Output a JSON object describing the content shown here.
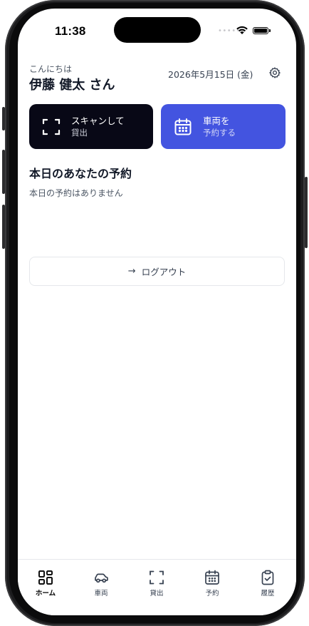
{
  "status_bar": {
    "time": "11:38"
  },
  "header": {
    "greeting": "こんにちは",
    "user_name": "伊藤 健太 さん",
    "date": "2026年5月15日 (金)",
    "settings_icon": "gear-icon"
  },
  "actions": {
    "scan": {
      "line1": "スキャンして",
      "line2": "貸出",
      "icon": "scan-frame-icon",
      "color": "#080816"
    },
    "reserve": {
      "line1": "車両を",
      "line2": "予約する",
      "icon": "calendar-icon",
      "color": "#4354e0"
    }
  },
  "today": {
    "title": "本日のあなたの予約",
    "empty_message": "本日の予約はありません"
  },
  "logout": {
    "label": "ログアウト",
    "icon": "arrow-right-icon"
  },
  "tabs": [
    {
      "label": "ホーム",
      "icon": "grid-icon",
      "active": true
    },
    {
      "label": "車両",
      "icon": "car-icon",
      "active": false
    },
    {
      "label": "貸出",
      "icon": "scan-frame-icon",
      "active": false
    },
    {
      "label": "予約",
      "icon": "calendar-icon",
      "active": false
    },
    {
      "label": "履歴",
      "icon": "clipboard-check-icon",
      "active": false
    }
  ]
}
